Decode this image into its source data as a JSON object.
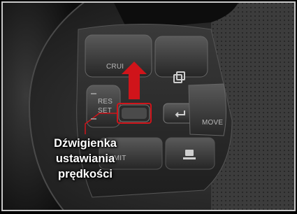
{
  "image": {
    "callout_lines": [
      "Dźwigienka",
      "ustawiania",
      "prędkości"
    ],
    "button_labels": {
      "cruise": "CRUI",
      "res": "RES",
      "set": "SET",
      "move": "MOVE",
      "limit": "LIMIT"
    },
    "colors": {
      "highlight": "#d0141a",
      "callout_text": "#ffffff"
    },
    "icons": [
      "arrow-up-icon",
      "lane-keep-icon",
      "distance-icon",
      "display-mode-icon"
    ]
  }
}
